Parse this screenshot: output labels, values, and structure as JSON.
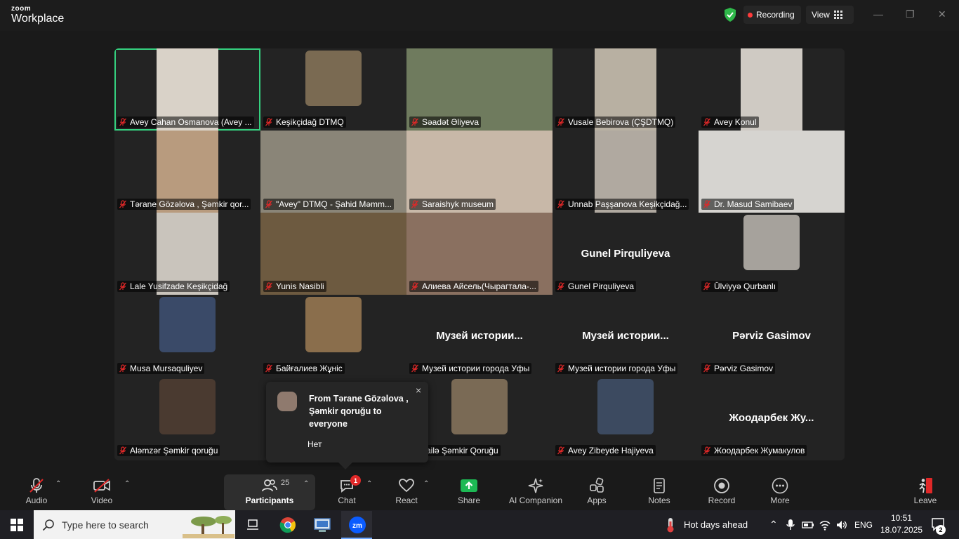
{
  "app": {
    "brand_top": "zoom",
    "brand_bottom": "Workplace"
  },
  "topbar": {
    "recording_label": "Recording",
    "view_label": "View",
    "minimize": "—",
    "restore": "❐",
    "close": "✕"
  },
  "tiles": [
    {
      "name": "Avey Cahan Osmanova (Avey ...",
      "active": true,
      "photo_color": "#d9d2c8"
    },
    {
      "name": "Keşikçidağ DTMQ",
      "photo_color": "#7a6a52",
      "small": true
    },
    {
      "name": "Səadət Əliyeva",
      "photo_color": "#6f7b5e"
    },
    {
      "name": "Vusale Bebirova (ÇŞDTMQ)",
      "photo_color": "#b8b0a2"
    },
    {
      "name": "Avey Konul",
      "photo_color": "#cfcac3"
    },
    {
      "name": "Tərane Gözəlova , Şəmkir qor...",
      "photo_color": "#b89b7e"
    },
    {
      "name": "\"Avey\" DTMQ - Şahid Məmm...",
      "photo_color": "#8a8578"
    },
    {
      "name": "Saraishyk museum",
      "photo_color": "#c8b8a8"
    },
    {
      "name": "Unnab Paşşanova Keşikçidağ...",
      "photo_color": "#b0a9a0"
    },
    {
      "name": "Dr. Masud Samibaev",
      "photo_color": "#d6d4d0"
    },
    {
      "name": "Lale Yusifzade Keşikçidağ",
      "photo_color": "#c9c4bc"
    },
    {
      "name": "Yunis Nasibli",
      "photo_color": "#6d5a40"
    },
    {
      "name": "Алиева Айсель(Чырагтала-...",
      "photo_color": "#8a7060"
    },
    {
      "name": "Gunel Pirquliyeva",
      "big": "Gunel Pirquliyeva"
    },
    {
      "name": "Ülviyyə Qurbanlı",
      "photo_color": "#a6a29c",
      "small": true
    },
    {
      "name": "Musa Mursaquliyev",
      "photo_color": "#3a4a68",
      "small": true
    },
    {
      "name": "Байғалиев Жұніс",
      "photo_color": "#8a6e4c",
      "small": true
    },
    {
      "name": "Музей истории города Уфы",
      "big": "Музей истории..."
    },
    {
      "name": "Музей истории города Уфы",
      "big": "Музей истории..."
    },
    {
      "name": "Pərviz Gasimov",
      "big": "Pərviz Gasimov"
    },
    {
      "name": "Aləmzər Şəmkir qoruğu",
      "photo_color": "#4a3a30",
      "small": true
    },
    {
      "name": "",
      "photo_color": ""
    },
    {
      "name": "Jailə Şəmkir Qoruğu",
      "photo_color": "#7a6a55",
      "small": true
    },
    {
      "name": "Avey Zibeyde Hajiyeva",
      "photo_color": "#3c4a60",
      "small": true
    },
    {
      "name": "Жоодарбек Жумакулов",
      "big": "Жоодарбек Жу..."
    }
  ],
  "chat_popup": {
    "from": "From Tərane Gözəlova , Şəmkir qoruğu to everyone",
    "message": "Нет",
    "close": "×"
  },
  "toolbar": {
    "audio": "Audio",
    "video": "Video",
    "participants": "Participants",
    "participants_count": "25",
    "chat": "Chat",
    "chat_badge": "1",
    "react": "React",
    "share": "Share",
    "ai": "AI Companion",
    "apps": "Apps",
    "notes": "Notes",
    "record": "Record",
    "more": "More",
    "leave": "Leave"
  },
  "taskbar": {
    "search_placeholder": "Type here to search",
    "weather": "Hot days ahead",
    "lang": "ENG",
    "time": "10:51",
    "date": "18.07.2025",
    "notif_count": "2"
  },
  "colors": {
    "active_speaker": "#35d07f",
    "share_green": "#1db954",
    "badge_red": "#e02828",
    "muted_red": "#e02828"
  }
}
